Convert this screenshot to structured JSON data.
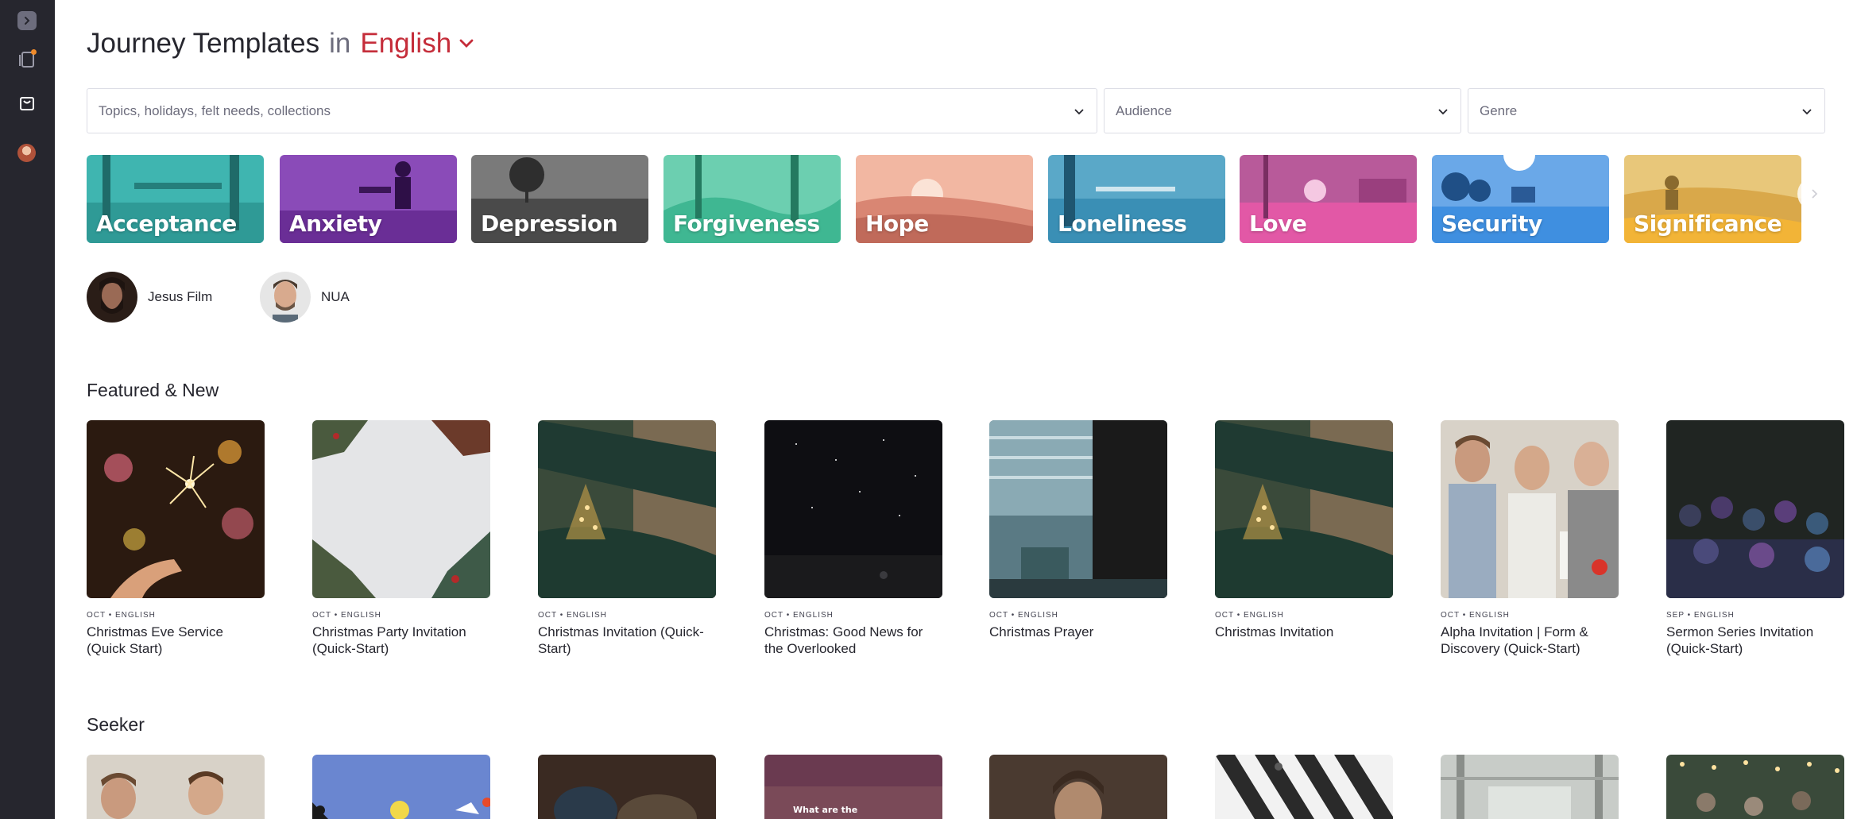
{
  "heading": {
    "title": "Journey Templates",
    "connector": "in",
    "language": "English"
  },
  "filters": {
    "topics_placeholder": "Topics, holidays, felt needs, collections",
    "audience_placeholder": "Audience",
    "genre_placeholder": "Genre"
  },
  "tags": [
    {
      "label": "Acceptance",
      "color": "#3fb5b0"
    },
    {
      "label": "Anxiety",
      "color": "#7a3fa6"
    },
    {
      "label": "Depression",
      "color": "#4a4a4a"
    },
    {
      "label": "Forgiveness",
      "color": "#3fb792"
    },
    {
      "label": "Hope",
      "color": "#e59a85"
    },
    {
      "label": "Loneliness",
      "color": "#3a8fb5"
    },
    {
      "label": "Love",
      "color": "#e258a6"
    },
    {
      "label": "Security",
      "color": "#3f8fe0"
    },
    {
      "label": "Significance",
      "color": "#f2b437"
    }
  ],
  "creators": [
    {
      "name": "Jesus Film"
    },
    {
      "name": "NUA"
    }
  ],
  "sections": {
    "featured_title": "Featured & New",
    "seeker_title": "Seeker"
  },
  "featured": [
    {
      "meta": "OCT • ENGLISH",
      "title": "Christmas Eve Service (Quick Start)"
    },
    {
      "meta": "OCT • ENGLISH",
      "title": "Christmas Party Invitation (Quick-Start)"
    },
    {
      "meta": "OCT • ENGLISH",
      "title": "Christmas Invitation (Quick-Start)"
    },
    {
      "meta": "OCT • ENGLISH",
      "title": "Christmas: Good News for the Overlooked"
    },
    {
      "meta": "OCT • ENGLISH",
      "title": "Christmas Prayer"
    },
    {
      "meta": "OCT • ENGLISH",
      "title": "Christmas Invitation"
    },
    {
      "meta": "OCT • ENGLISH",
      "title": "Alpha Invitation | Form & Discovery (Quick-Start)"
    },
    {
      "meta": "SEP • ENGLISH",
      "title": "Sermon Series Invitation (Quick-Start)"
    }
  ],
  "seeker_thumb_text": "What are the",
  "colors": {
    "accent": "#c52d3a",
    "sidebar": "#26262e",
    "notification": "#ef8a2a"
  }
}
